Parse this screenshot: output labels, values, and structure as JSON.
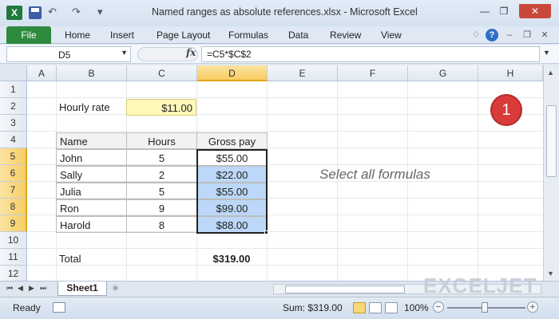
{
  "window": {
    "title": "Named ranges as absolute references.xlsx  -  Microsoft Excel",
    "app_icon": "X",
    "minimize_icon": "—",
    "restore_icon": "❐",
    "close_icon": "✕"
  },
  "qat": {
    "undo_icon": "↶",
    "redo_icon": "↷",
    "customize_icon": "▾"
  },
  "ribbon": {
    "file_tab": "File",
    "tabs": [
      "Home",
      "Insert",
      "Page Layout",
      "Formulas",
      "Data",
      "Review",
      "View"
    ],
    "help_icon": "?"
  },
  "formula_bar": {
    "name_box": "D5",
    "fx_label": "fx",
    "formula": "=C5*$C$2"
  },
  "columns": [
    "A",
    "B",
    "C",
    "D",
    "E",
    "F",
    "G",
    "H"
  ],
  "selected_column": "D",
  "rows": [
    "1",
    "2",
    "3",
    "4",
    "5",
    "6",
    "7",
    "8",
    "9",
    "10",
    "11",
    "12"
  ],
  "selected_rows": [
    "5",
    "6",
    "7",
    "8",
    "9"
  ],
  "cells": {
    "hourly_rate_label": "Hourly rate",
    "hourly_rate_value": "$11.00",
    "header_name": "Name",
    "header_hours": "Hours",
    "header_gross": "Gross pay",
    "data": [
      {
        "name": "John",
        "hours": "5",
        "gross": "$55.00"
      },
      {
        "name": "Sally",
        "hours": "2",
        "gross": "$22.00"
      },
      {
        "name": "Julia",
        "hours": "5",
        "gross": "$55.00"
      },
      {
        "name": "Ron",
        "hours": "9",
        "gross": "$99.00"
      },
      {
        "name": "Harold",
        "hours": "8",
        "gross": "$88.00"
      }
    ],
    "total_label": "Total",
    "total_value": "$319.00"
  },
  "annotation": {
    "note": "Select all formulas",
    "badge": "1"
  },
  "sheet_tabs": {
    "active": "Sheet1"
  },
  "watermark": "EXCELJET",
  "status_bar": {
    "ready": "Ready",
    "sum": "Sum: $319.00",
    "zoom": "100%",
    "zoom_minus": "−",
    "zoom_plus": "+"
  },
  "colors": {
    "file_tab": "#2e8a3e",
    "selection_fill": "#bcd7f7",
    "input_cell": "#fff8b8",
    "badge": "#d93a3a"
  }
}
